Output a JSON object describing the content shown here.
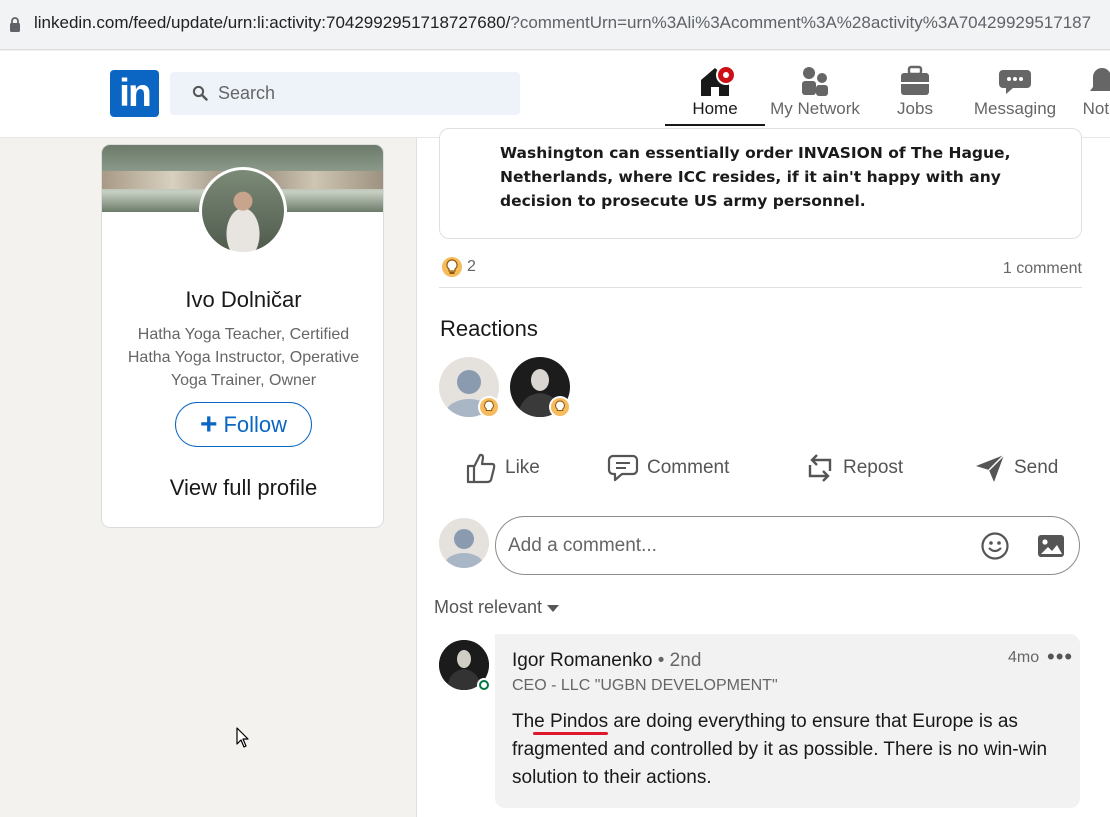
{
  "browser": {
    "url_main": "linkedin.com/feed/update/urn:li:activity:7042992951718727680/",
    "url_rest": "?commentUrn=urn%3Ali%3Acomment%3A%28activity%3A70429929517187"
  },
  "nav": {
    "logo": "in",
    "search_placeholder": "Search",
    "items": [
      {
        "label": "Home"
      },
      {
        "label": "My Network"
      },
      {
        "label": "Jobs"
      },
      {
        "label": "Messaging"
      },
      {
        "label": "Notifi"
      }
    ]
  },
  "profile": {
    "name": "Ivo Dolničar",
    "headline": "Hatha Yoga Teacher, Certified Hatha Yoga Instructor, Operative Yoga Trainer, Owner",
    "follow_label": "Follow",
    "view_profile_label": "View full profile"
  },
  "post": {
    "quote": "Washington can essentially order INVASION of The Hague, Netherlands, where ICC resides, if it ain't happy with any decision to prosecute US army personnel.",
    "reaction_count": "2",
    "comment_count": "1 comment",
    "reactions_title": "Reactions"
  },
  "actions": {
    "like": "Like",
    "comment": "Comment",
    "repost": "Repost",
    "send": "Send"
  },
  "comment_box": {
    "placeholder": "Add a comment..."
  },
  "sort": {
    "label": "Most relevant"
  },
  "comment": {
    "author": "Igor Romanenko",
    "degree": "• 2nd",
    "headline": "CEO - LLC \"UGBN DEVELOPMENT\"",
    "time": "4mo",
    "more": "•••",
    "text": "The Pindos are doing everything to ensure that Europe is as fragmented and controlled by it as possible. There is no win-win solution to their actions."
  },
  "colors": {
    "brand": "#0a66c2",
    "notification": "#cc1016",
    "online": "#057642",
    "spellcheck": "#e0182d"
  }
}
